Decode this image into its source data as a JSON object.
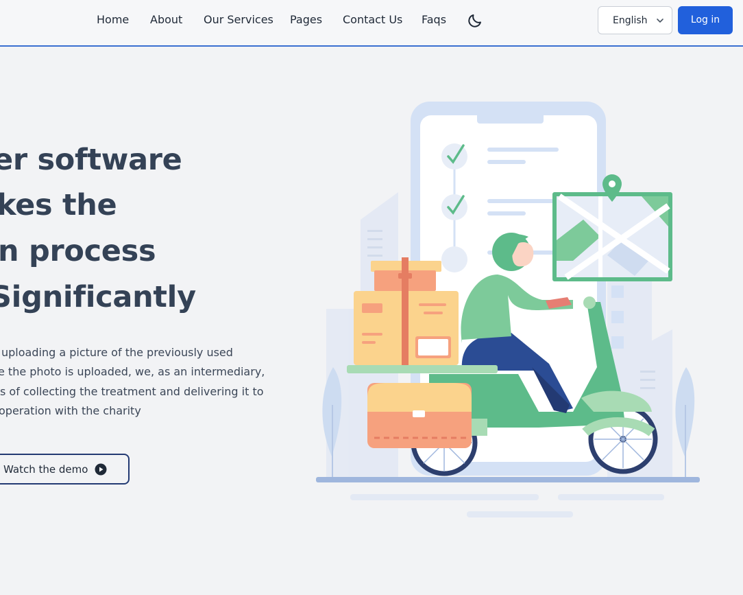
{
  "nav": {
    "links": [
      "Home",
      "About",
      "Our Services",
      "Pages",
      "Contact Us",
      "Faqs"
    ],
    "theme_icon": "moon-icon",
    "language": {
      "selected": "English",
      "icon": "chevron-down-icon"
    },
    "login_label": "Log in"
  },
  "hero": {
    "title_lines": [
      "er software",
      "kes the",
      "n process",
      "Significantly"
    ],
    "description_lines": [
      "uploading a picture of the previously used",
      "e the photo is uploaded, we, as an intermediary,",
      "s of collecting the treatment and delivering it to",
      "operation with the charity"
    ],
    "demo_button": {
      "label": "Watch the demo",
      "icon": "play-icon"
    }
  },
  "illustration": {
    "subject": "delivery-scooter-illustration",
    "colors": {
      "green": "#5dbb8a",
      "peach": "#f6a17e",
      "box": "#fbd38d",
      "phone": "#d4e1f5",
      "navy": "#2b4c94"
    }
  }
}
